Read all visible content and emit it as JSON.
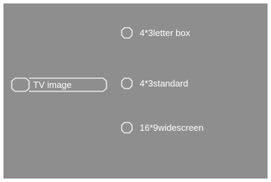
{
  "menu": {
    "tv_image_label": "TV image",
    "options": [
      {
        "label": "4*3letter box"
      },
      {
        "label": "4*3standard"
      },
      {
        "label": "16*9widescreen"
      }
    ]
  },
  "colors": {
    "background": "#8e8e8e",
    "foreground": "#ffffff"
  },
  "icons": {
    "option": "radio-octagon-icon",
    "menu_item": "selection-frame-icon"
  }
}
